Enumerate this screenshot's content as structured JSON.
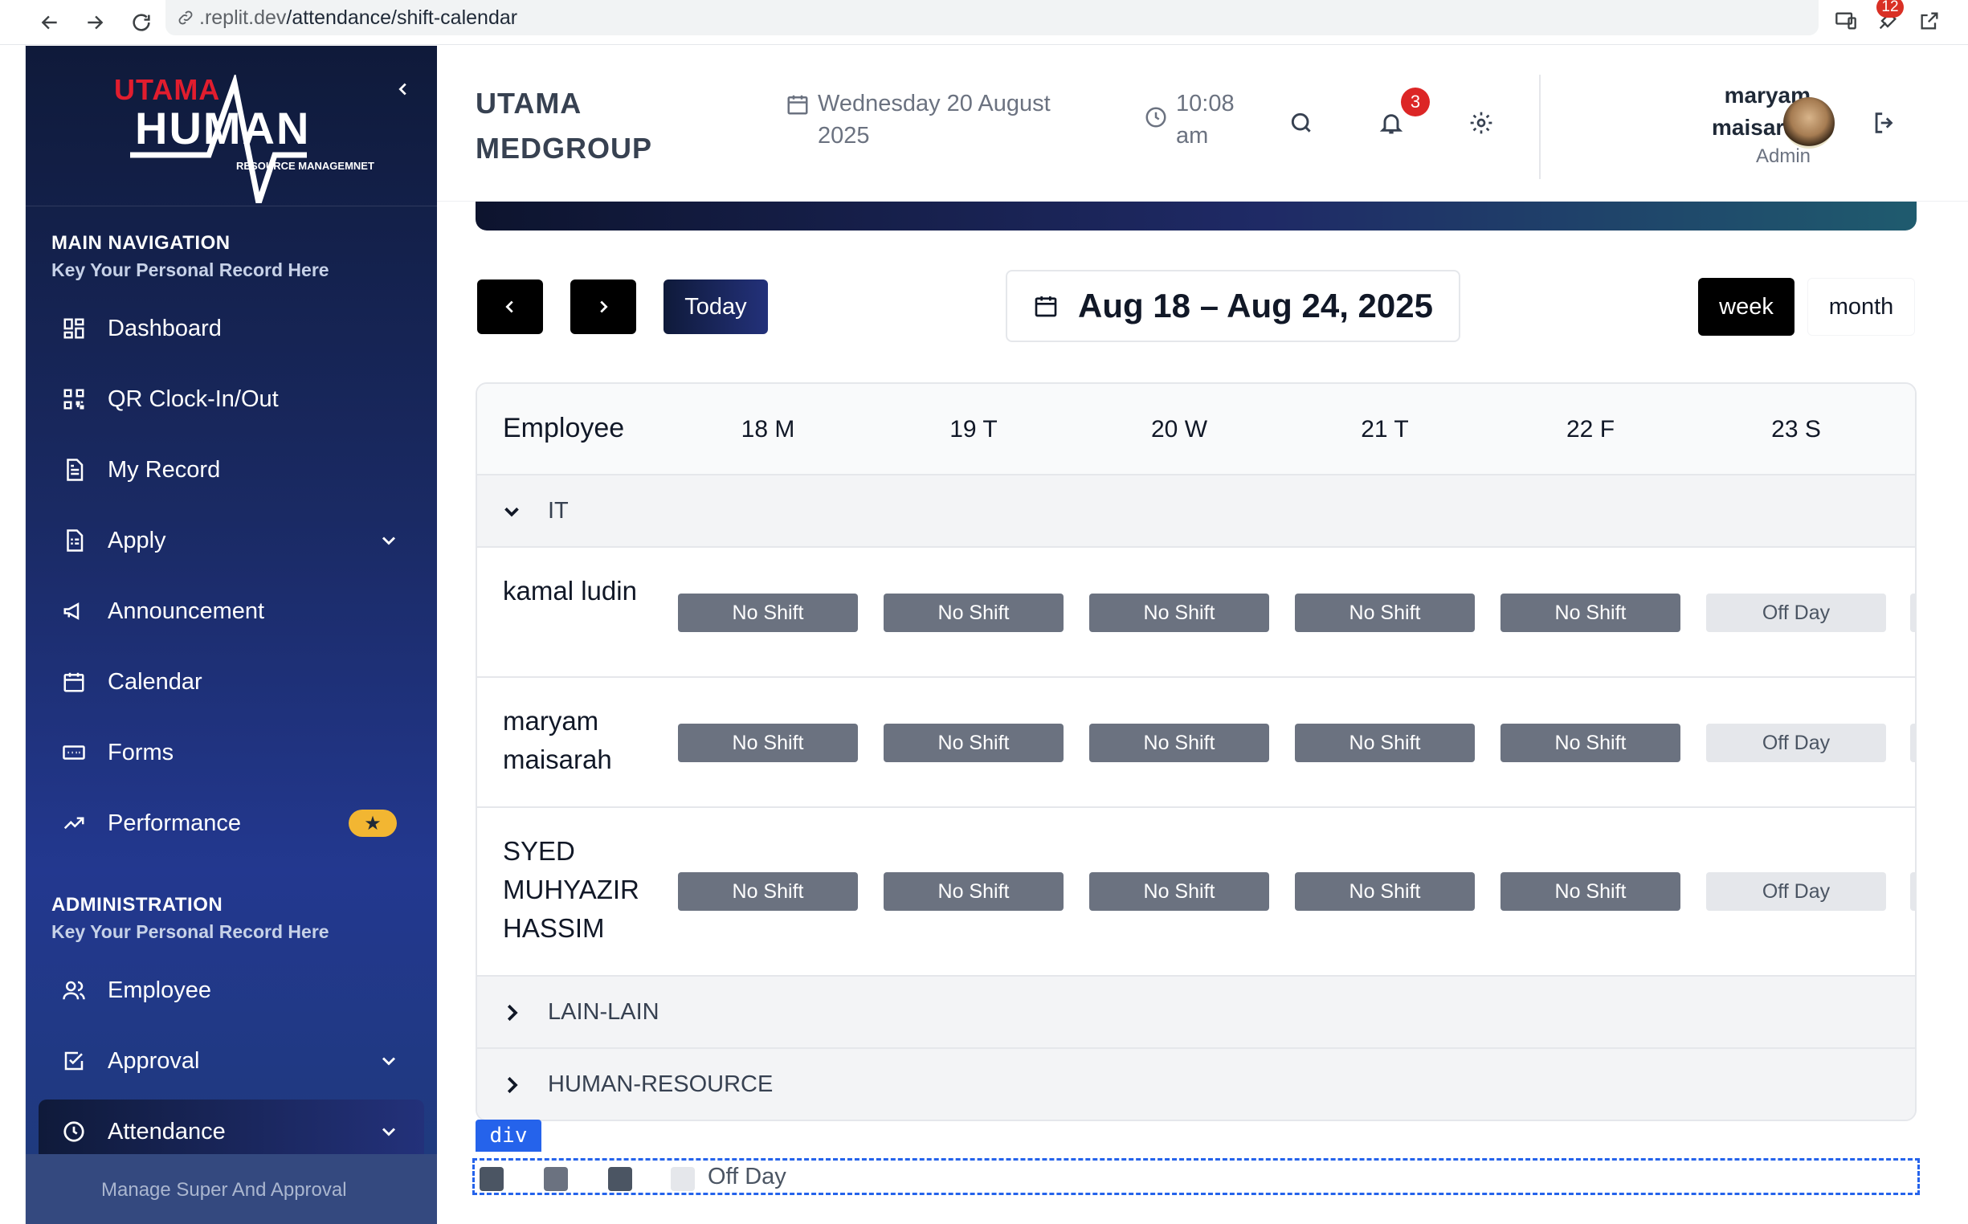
{
  "browser": {
    "url_prefix": ".replit.dev",
    "url_path": "/attendance/shift-calendar",
    "extension_badge": "12"
  },
  "sidebar": {
    "logo": {
      "top": "UTAMA",
      "main": "HUMAN",
      "sub": "RESOURCE MANAGEMNET"
    },
    "main_nav": {
      "title": "MAIN NAVIGATION",
      "subtitle": "Key Your Personal Record Here"
    },
    "items": [
      {
        "label": "Dashboard",
        "icon": "dashboard-icon"
      },
      {
        "label": "QR Clock-In/Out",
        "icon": "qr-icon"
      },
      {
        "label": "My Record",
        "icon": "document-icon"
      },
      {
        "label": "Apply",
        "icon": "form-icon",
        "expandable": true
      },
      {
        "label": "Announcement",
        "icon": "megaphone-icon"
      },
      {
        "label": "Calendar",
        "icon": "calendar-icon"
      },
      {
        "label": "Forms",
        "icon": "forms-icon"
      },
      {
        "label": "Performance",
        "icon": "trend-icon",
        "badge": "★"
      }
    ],
    "admin": {
      "title": "ADMINISTRATION",
      "subtitle": "Key Your Personal Record Here"
    },
    "admin_items": [
      {
        "label": "Employee",
        "icon": "users-icon"
      },
      {
        "label": "Approval",
        "icon": "check-square-icon",
        "expandable": true
      },
      {
        "label": "Attendance",
        "icon": "clock-icon",
        "expandable": true,
        "active": true
      }
    ],
    "sub_item": "Manage Super And Approval"
  },
  "header": {
    "company": "UTAMA MEDGROUP",
    "date": "Wednesday 20 August 2025",
    "time": "10:08 am",
    "notifications": "3",
    "user_name": "maryam maisarah",
    "user_role": "Admin"
  },
  "toolbar": {
    "today": "Today",
    "range": "Aug 18 – Aug 24, 2025",
    "view_week": "week",
    "view_month": "month"
  },
  "calendar": {
    "employee_header": "Employee",
    "days": [
      "18 M",
      "19 T",
      "20 W",
      "21 T",
      "22 F",
      "23 S"
    ],
    "groups": [
      {
        "name": "IT",
        "expanded": true,
        "employees": [
          {
            "name": "kamal ludin",
            "shifts": [
              "No Shift",
              "No Shift",
              "No Shift",
              "No Shift",
              "No Shift",
              "Off Day"
            ]
          },
          {
            "name": "maryam maisarah",
            "shifts": [
              "No Shift",
              "No Shift",
              "No Shift",
              "No Shift",
              "No Shift",
              "Off Day"
            ]
          },
          {
            "name": "SYED MUHYAZIR HASSIM",
            "shifts": [
              "No Shift",
              "No Shift",
              "No Shift",
              "No Shift",
              "No Shift",
              "Off Day"
            ]
          }
        ]
      },
      {
        "name": "LAIN-LAIN",
        "expanded": false
      },
      {
        "name": "HUMAN-RESOURCE",
        "expanded": false
      }
    ]
  },
  "legend": {
    "tag": "div",
    "label": "Off Day",
    "colors": [
      "#4b5563",
      "#6b7280",
      "#4b5563",
      "#e5e7eb"
    ]
  }
}
